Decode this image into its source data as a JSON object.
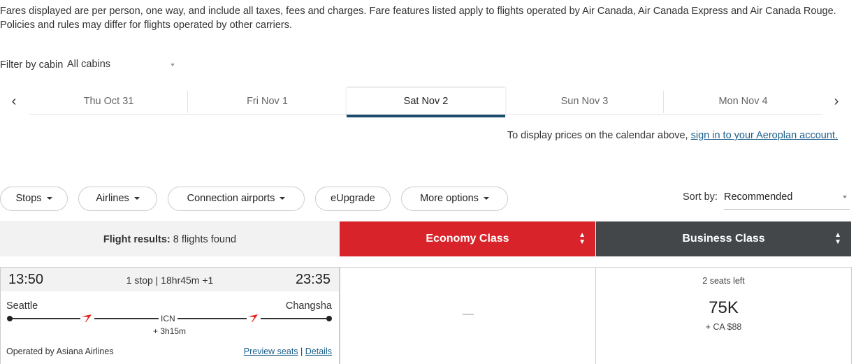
{
  "disclaimer": "Fares displayed are per person, one way, and include all taxes, fees and charges. Fare features listed apply to flights operated by Air Canada, Air Canada Express and Air Canada Rouge. Policies and rules may differ for flights operated by other carriers.",
  "filter": {
    "label": "Filter by cabin",
    "value": "All cabins"
  },
  "date_nav": {
    "prev_icon": "‹",
    "next_icon": "›",
    "dates": [
      {
        "label": "Thu Oct 31"
      },
      {
        "label": "Fri Nov 1"
      },
      {
        "label": "Sat Nov 2",
        "selected": true
      },
      {
        "label": "Sun Nov 3"
      },
      {
        "label": "Mon Nov 4"
      }
    ]
  },
  "signin": {
    "text": "To display prices on the calendar above,",
    "link": "sign in to your Aeroplan account."
  },
  "filters": [
    "Stops",
    "Airlines",
    "Connection airports",
    "eUpgrade",
    "More options"
  ],
  "sort": {
    "label": "Sort by:",
    "value": "Recommended"
  },
  "results": {
    "label": "Flight results:",
    "count": "8 flights found"
  },
  "columns": {
    "economy": "Economy Class",
    "business": "Business Class"
  },
  "flight": {
    "depart_time": "13:50",
    "arrive_time": "23:35",
    "summary": "1 stop | 18hr45m +1",
    "origin": "Seattle",
    "destination": "Changsha",
    "layover_code": "ICN",
    "layover_duration": "+ 3h15m",
    "operated_by": "Operated by Asiana Airlines",
    "preview_seats": "Preview seats",
    "details": "Details",
    "economy_fare": "—",
    "business": {
      "seats_left": "2 seats left",
      "miles": "75K",
      "taxes": "+ CA $88"
    }
  },
  "colors": {
    "economy": "#d8232a",
    "business": "#43474a",
    "link": "#1b5e8a",
    "tab_active": "#1c4c6b"
  }
}
